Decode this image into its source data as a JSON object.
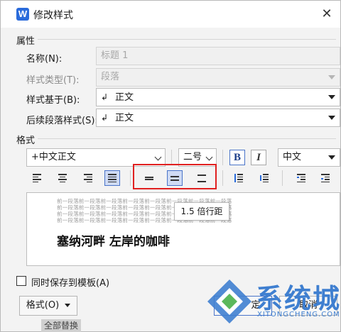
{
  "titlebar": {
    "title": "修改样式",
    "close_glyph": "✕"
  },
  "attributes": {
    "section_label": "属性",
    "name_label": "名称(N):",
    "name_value": "标题 1",
    "style_type_label": "样式类型(T):",
    "style_type_value": "段落",
    "based_on_label": "样式基于(B):",
    "based_on_value": "正文",
    "next_style_label": "后续段落样式(S):",
    "next_style_value": "正文",
    "enter_glyph": "↲"
  },
  "format": {
    "section_label": "格式",
    "font_name": "+中文正文",
    "font_size": "二号",
    "bold_label": "B",
    "italic_label": "I",
    "script": "中文"
  },
  "preview": {
    "text_lines": [
      "前一段落前一段落前一段落前一段落前一段落前一段落前一段落前一段落",
      "前一段落前一段落前一段落前一段落前一段落前一段落前一段落前一段落",
      "前一段落前一段落前一段落前一段落前一段落前一段落前一段落前一段落",
      "前一段落前一段落前一段落前一段落前一段落前一段落前一段落前一段落"
    ],
    "sample_text": "塞纳河畔 左岸的咖啡",
    "tooltip": "1.5 倍行距"
  },
  "footer": {
    "checkbox_label": "同时保存到模板(A)",
    "format_button_label": "格式(O)",
    "ok_button_label": "定",
    "cancel_button_label": "取消",
    "bottom_strip": "全部替换"
  },
  "watermark": {
    "text": "系统城",
    "sub": "XITONGCHENG.COM"
  },
  "colors": {
    "accent": "#4a74c9",
    "highlight": "#e02020",
    "watermark": "#3f7fd0"
  }
}
